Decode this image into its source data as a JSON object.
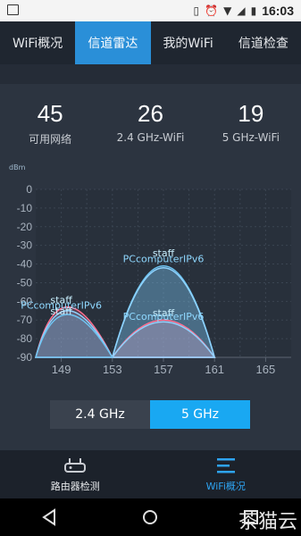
{
  "status": {
    "time": "16:03"
  },
  "tabs": [
    {
      "label": "WiFi概况",
      "active": false
    },
    {
      "label": "信道雷达",
      "active": true
    },
    {
      "label": "我的WiFi",
      "active": false
    },
    {
      "label": "信道检查",
      "active": false
    }
  ],
  "stats": [
    {
      "value": "45",
      "label": "可用网络"
    },
    {
      "value": "26",
      "label": "2.4 GHz-WiFi"
    },
    {
      "value": "19",
      "label": "5 GHz-WiFi"
    }
  ],
  "chart_data": {
    "type": "area",
    "ylabel": "dBm",
    "ylim": [
      -90,
      0
    ],
    "yticks": [
      "0",
      "-10",
      "-20",
      "-30",
      "-40",
      "-50",
      "-60",
      "-70",
      "-80",
      "-90"
    ],
    "xticks": [
      "149",
      "153",
      "157",
      "161",
      "165"
    ],
    "annotations": [
      {
        "text": "staff",
        "channel": 157,
        "dbm": -36
      },
      {
        "text": "PCcomputerIPv6",
        "channel": 157,
        "dbm": -39
      },
      {
        "text": "staff",
        "channel": 157,
        "dbm": -68
      },
      {
        "text": "PCcomputerIPv6",
        "channel": 157,
        "dbm": -70
      },
      {
        "text": "staff",
        "channel": 149,
        "dbm": -61
      },
      {
        "text": "PCcomputerIPv6",
        "channel": 149,
        "dbm": -64
      },
      {
        "text": "staff",
        "channel": 149,
        "dbm": -67
      }
    ],
    "series": [
      {
        "channel": 157,
        "dbm": -41,
        "color": "#6fc3f0"
      },
      {
        "channel": 157,
        "dbm": -42,
        "color": "#8fd3ff"
      },
      {
        "channel": 157,
        "dbm": -70,
        "color": "#ff6f8f"
      },
      {
        "channel": 157,
        "dbm": -71,
        "color": "#8fd3ff"
      },
      {
        "channel": 149,
        "dbm": -63,
        "color": "#ff6f8f"
      },
      {
        "channel": 149,
        "dbm": -65,
        "color": "#8fd3ff"
      },
      {
        "channel": 149,
        "dbm": -67,
        "color": "#6fc3f0"
      }
    ]
  },
  "band_toggle": {
    "option1": "2.4 GHz",
    "option2": "5 GHz",
    "selected": "5 GHz"
  },
  "bottom_nav": [
    {
      "label": "路由器检测",
      "icon": "router-icon",
      "active": false
    },
    {
      "label": "WiFi概况",
      "icon": "menu-lines-icon",
      "active": true
    }
  ],
  "watermark": "茶猫云"
}
